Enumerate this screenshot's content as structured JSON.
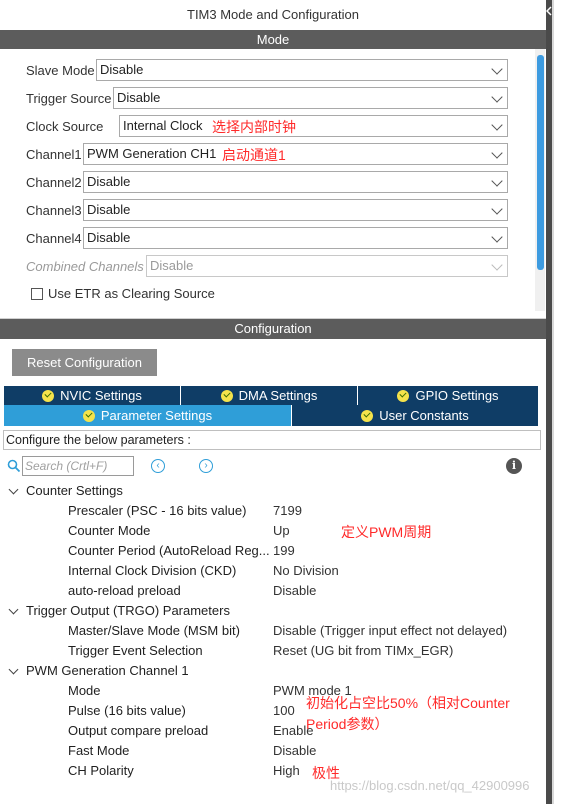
{
  "title": "TIM3 Mode and Configuration",
  "mode_header": "Mode",
  "mode_rows": [
    {
      "label": "Slave Mode",
      "value": "Disable",
      "annotation": ""
    },
    {
      "label": "Trigger Source",
      "value": "Disable",
      "annotation": ""
    },
    {
      "label": "Clock Source",
      "value": "Internal Clock",
      "annotation": "选择内部时钟"
    },
    {
      "label": "Channel1",
      "value": "PWM Generation CH1",
      "annotation": "启动通道1"
    },
    {
      "label": "Channel2",
      "value": "Disable",
      "annotation": ""
    },
    {
      "label": "Channel3",
      "value": "Disable",
      "annotation": ""
    },
    {
      "label": "Channel4",
      "value": "Disable",
      "annotation": ""
    },
    {
      "label": "Combined Channels",
      "value": "Disable",
      "annotation": ""
    }
  ],
  "etr_checkbox_label": "Use ETR as Clearing Source",
  "config_header": "Configuration",
  "reset_button": "Reset Configuration",
  "tabs_row1": [
    "NVIC Settings",
    "DMA Settings",
    "GPIO Settings"
  ],
  "tabs_row2": [
    "Parameter Settings",
    "User Constants"
  ],
  "configure_text": "Configure the below parameters :",
  "search_placeholder": "Search (Crtl+F)",
  "groups": [
    {
      "name": "Counter Settings",
      "params": [
        {
          "name": "Prescaler (PSC - 16 bits value)",
          "value": "7199"
        },
        {
          "name": "Counter Mode",
          "value": "Up"
        },
        {
          "name": "Counter Period (AutoReload Reg...",
          "value": "199"
        },
        {
          "name": "Internal Clock Division (CKD)",
          "value": "No Division"
        },
        {
          "name": "auto-reload preload",
          "value": "Disable"
        }
      ]
    },
    {
      "name": "Trigger Output (TRGO) Parameters",
      "params": [
        {
          "name": "Master/Slave Mode (MSM bit)",
          "value": "Disable (Trigger input effect not delayed)"
        },
        {
          "name": "Trigger Event Selection",
          "value": "Reset (UG bit from TIMx_EGR)"
        }
      ]
    },
    {
      "name": "PWM Generation Channel 1",
      "params": [
        {
          "name": "Mode",
          "value": "PWM mode 1"
        },
        {
          "name": "Pulse (16 bits value)",
          "value": "100"
        },
        {
          "name": "Output compare preload",
          "value": "Enable"
        },
        {
          "name": "Fast Mode",
          "value": "Disable"
        },
        {
          "name": "CH Polarity",
          "value": "High"
        }
      ]
    }
  ],
  "annotations": {
    "counter_period": "定义PWM周期",
    "pulse_line1": "初始化占空比50%（相对Counter",
    "pulse_line2": "Period参数）",
    "polarity": "极性"
  },
  "watermark": "https://blog.csdn.net/qq_42900996",
  "colors": {
    "section_header": "#5c5c5c",
    "tab_dark": "#0f3d66",
    "tab_active": "#2f9ed8",
    "annotation_red": "#ff2a2a",
    "scroll_thumb": "#3d9be0"
  }
}
